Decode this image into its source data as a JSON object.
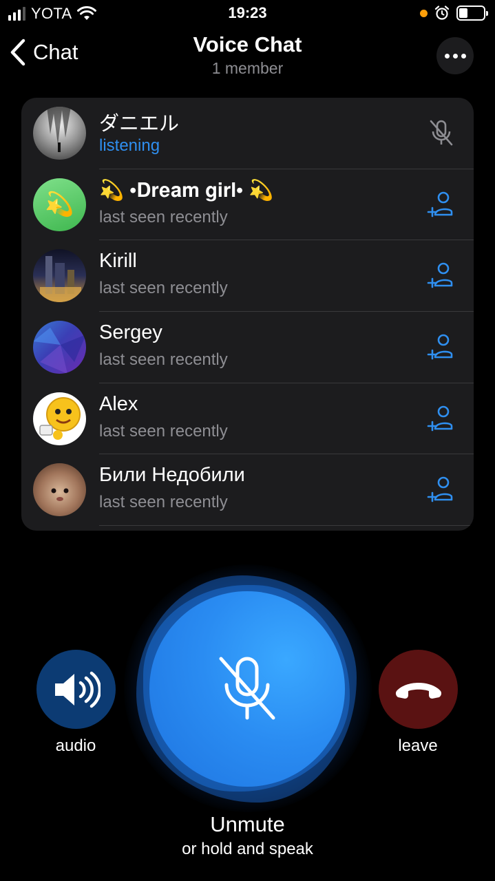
{
  "status_bar": {
    "carrier": "YOTA",
    "time": "19:23"
  },
  "nav": {
    "back_label": "Chat",
    "title": "Voice Chat",
    "subtitle": "1 member"
  },
  "participants": [
    {
      "name": "ダニエル",
      "status": "listening"
    },
    {
      "name": "💫 •𝐃𝐫𝐞𝐚𝐦 𝐠𝐢𝐫𝐥• 💫",
      "status": "last seen recently"
    },
    {
      "name": "Kirill",
      "status": "last seen recently"
    },
    {
      "name": "Sergey",
      "status": "last seen recently"
    },
    {
      "name": "Alex",
      "status": "last seen recently"
    },
    {
      "name": "Били Недобили",
      "status": "last seen recently"
    }
  ],
  "controls": {
    "audio_label": "audio",
    "leave_label": "leave",
    "unmute_label": "Unmute",
    "hold_label": "or hold and speak"
  },
  "colors": {
    "accent": "#2f8ff0",
    "leave": "#5a1212",
    "audio": "#0c3b73"
  }
}
